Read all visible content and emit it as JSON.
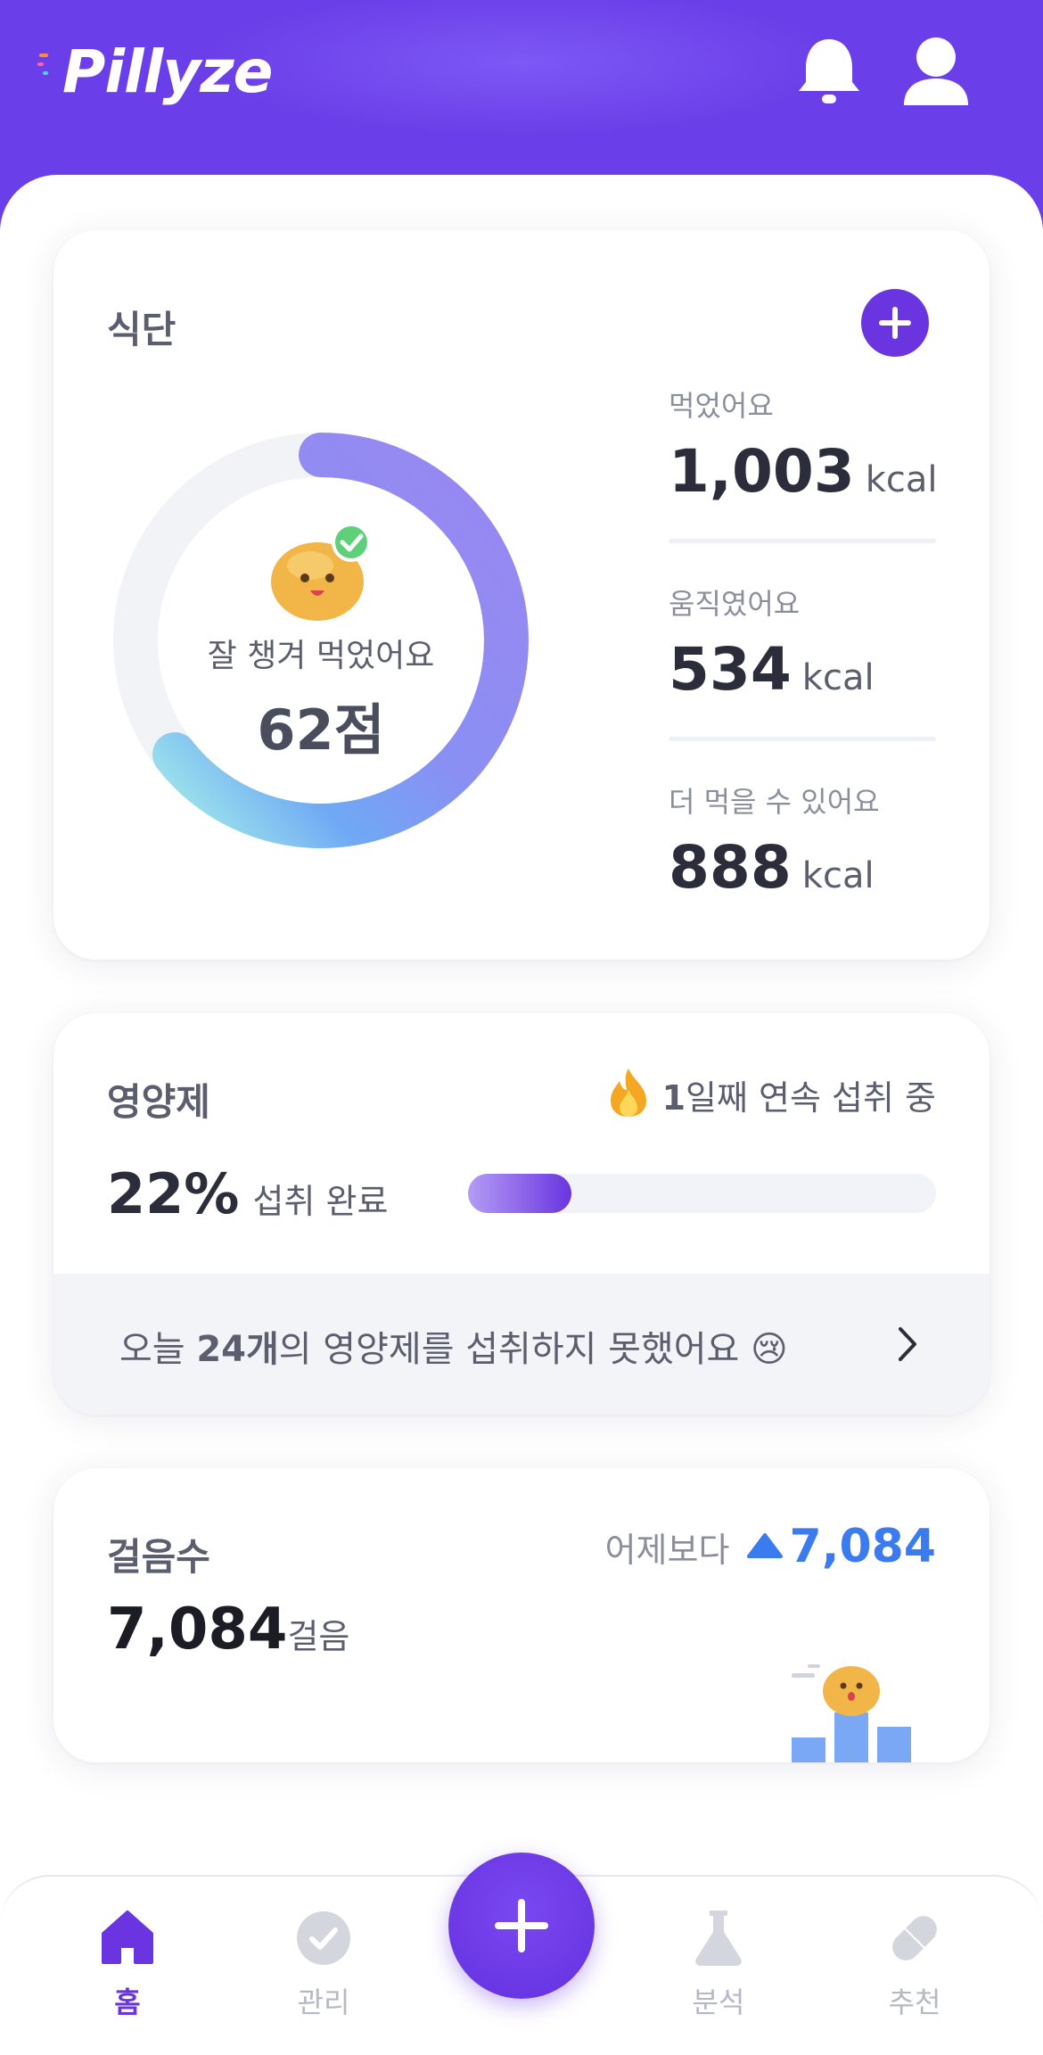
{
  "header": {
    "logo": "Pillyze",
    "colors": {
      "brand": "#6a3ee8",
      "accent": "#6a35e0"
    },
    "icons": [
      "bell-icon",
      "profile-icon"
    ]
  },
  "diet": {
    "title": "식단",
    "score_caption": "잘 챙겨 먹었어요",
    "score": "62점",
    "score_value": 62,
    "stats": [
      {
        "label": "먹었어요",
        "value": "1,003",
        "unit": "kcal"
      },
      {
        "label": "움직였어요",
        "value": "534",
        "unit": "kcal"
      },
      {
        "label": "더 먹을 수 있어요",
        "value": "888",
        "unit": "kcal"
      }
    ]
  },
  "supplements": {
    "title": "영양제",
    "streak_count": "1",
    "streak_text": "일째 연속 섭취 중",
    "percent": "22%",
    "percent_label": "섭취 완료",
    "progress_fraction": 0.22,
    "notice_prefix": "오늘 ",
    "notice_count": "24개",
    "notice_suffix": "의 영양제를 섭취하지 못했어요 😢"
  },
  "steps": {
    "title": "걸음수",
    "compare_label": "어제보다",
    "compare_value": "7,084",
    "count": "7,084",
    "unit": "걸음",
    "compare_color": "#3a7bf0"
  },
  "nav": {
    "items": [
      {
        "label": "홈",
        "icon": "home-icon",
        "active": true
      },
      {
        "label": "관리",
        "icon": "check-circle-icon",
        "active": false
      },
      {
        "label": "분석",
        "icon": "flask-icon",
        "active": false
      },
      {
        "label": "추천",
        "icon": "pill-icon",
        "active": false
      }
    ],
    "fab_icon": "plus-icon"
  }
}
